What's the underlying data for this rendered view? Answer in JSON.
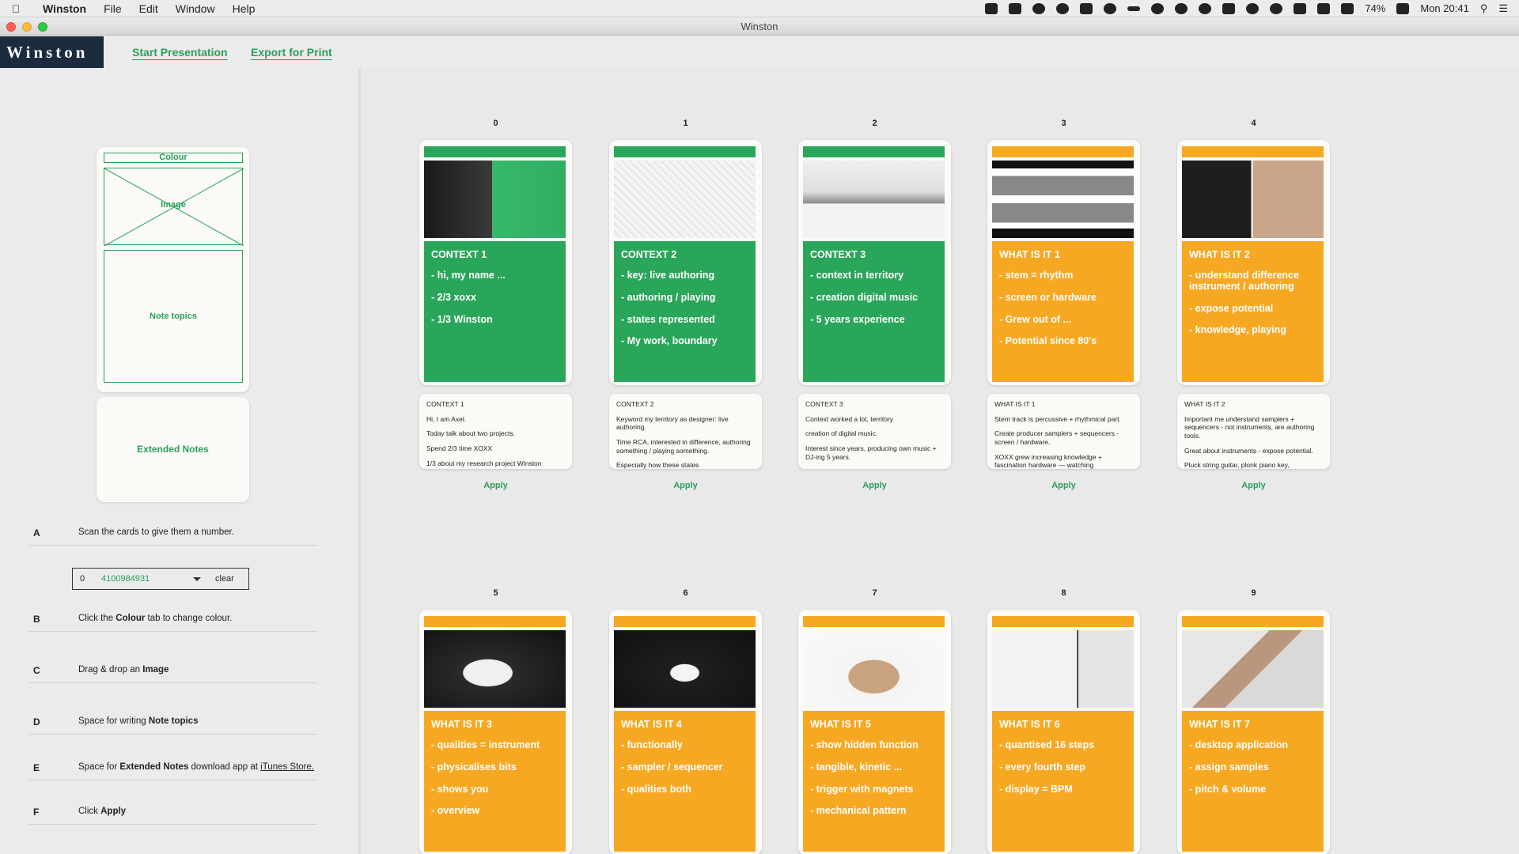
{
  "menubar": {
    "app_name": "Winston",
    "menus": [
      "File",
      "Edit",
      "Window",
      "Help"
    ],
    "battery": "74%",
    "clock": "Mon 20:41"
  },
  "window": {
    "title": "Winston"
  },
  "header": {
    "logo": "Winston",
    "start_presentation": "Start Presentation",
    "export_for_print": "Export for Print"
  },
  "legend": {
    "colour": "Colour",
    "image": "Image",
    "note_topics": "Note topics",
    "extended_notes": "Extended Notes"
  },
  "steps": [
    {
      "letter": "A",
      "text": "Scan the cards to give them a number."
    },
    {
      "letter": "B",
      "pre": "Click the ",
      "bold": "Colour",
      "post": " tab to change colour."
    },
    {
      "letter": "C",
      "pre": "Drag & drop an ",
      "bold": "Image"
    },
    {
      "letter": "D",
      "pre": "Space for writing  ",
      "bold": "Note topics"
    },
    {
      "letter": "E",
      "pre": "Space for ",
      "bold": "Extended Notes",
      "post": " download app at ",
      "link": "iTunes Store."
    },
    {
      "letter": "F",
      "pre": "Click  ",
      "bold": "Apply"
    }
  ],
  "scanner": {
    "number": "0",
    "code": "4100984931",
    "clear": "clear"
  },
  "colors": {
    "green": "#2aa65a",
    "orange": "#f7a823",
    "accent": "#2aa05a",
    "logo_bg": "#1c2a3d"
  },
  "apply_label": "Apply",
  "cards": [
    {
      "num": "0",
      "color": "green",
      "image": "hand-on-device-photo",
      "title": "CONTEXT 1",
      "topics": [
        "- hi, my name ...",
        "- 2/3 xoxx",
        "- 1/3 Winston"
      ],
      "note_title": "CONTEXT 1",
      "notes": [
        "Hi, I am Axel.",
        "Today talk about two projects.",
        "Spend 2/3 time XOXX",
        "1/3 about my research project Winston"
      ]
    },
    {
      "num": "1",
      "color": "green",
      "image": "sketch-collage",
      "title": "CONTEXT 2",
      "topics": [
        "- key: live authoring",
        "- authoring / playing",
        "- states represented",
        "- My work, boundary"
      ],
      "note_title": "CONTEXT 2",
      "notes": [
        "Keyword my territory as designer:  live authoring.",
        "Time RCA,  interested in difference, authoring something / playing something.",
        "Especially how these states"
      ]
    },
    {
      "num": "2",
      "color": "green",
      "image": "studio-shelf-photo",
      "title": "CONTEXT 3",
      "topics": [
        "- context in territory",
        "- creation digital music",
        "- 5 years experience"
      ],
      "note_title": "CONTEXT 3",
      "notes": [
        "Context worked a lot,  territory",
        "creation of digital music.",
        "Interest since years, producing own music + DJ-ing 5 years."
      ]
    },
    {
      "num": "3",
      "color": "orange",
      "image": "hardware-samplers-grid",
      "title": "WHAT IS IT 1",
      "topics": [
        "- stem  = rhythm",
        "- screen or hardware",
        "-  Grew out of ...",
        "- Potential since 80's"
      ],
      "note_title": "WHAT IS IT 1",
      "notes": [
        "Stem track is percussive + rhythmical part.",
        "Create producer samplers + sequencers -  screen / hardware.",
        "XOXX grew increasing knowledge + fascination hardware — watching"
      ]
    },
    {
      "num": "4",
      "color": "orange",
      "image": "sequencer-and-piano-photo",
      "title": "WHAT IS IT 2",
      "topics": [
        "- understand difference instrument / authoring",
        "- expose potential",
        "- knowledge, playing"
      ],
      "note_title": "WHAT IS IT 2",
      "notes": [
        "Important me understand samplers + sequencers - not instruments, are authoring tools.",
        "Great about instruments - expose potential.",
        "Pluck string  guitar, plonk piano key,"
      ]
    },
    {
      "num": "5",
      "color": "orange",
      "image": "disc-device-photo",
      "title": "WHAT IS IT 3",
      "topics": [
        "- qualities = instrument",
        "- physicalises bits",
        "- shows you",
        "- overview"
      ]
    },
    {
      "num": "6",
      "color": "orange",
      "image": "single-disc-device-photo",
      "title": "WHAT IS IT 4",
      "topics": [
        "- functionally",
        "- sampler / sequencer",
        "- qualities both"
      ]
    },
    {
      "num": "7",
      "color": "orange",
      "image": "man-holding-device-photo",
      "title": "WHAT IS IT 5",
      "topics": [
        "- show hidden function",
        "- tangible, kinetic ...",
        "- trigger with magnets",
        "- mechanical pattern"
      ]
    },
    {
      "num": "8",
      "color": "orange",
      "image": "disc-drawing-photo",
      "title": "WHAT IS IT 6",
      "topics": [
        "- quantised 16 steps",
        "- every fourth step",
        "- display = BPM"
      ]
    },
    {
      "num": "9",
      "color": "orange",
      "image": "desktop-app-photo",
      "title": "WHAT IS IT 7",
      "topics": [
        "- desktop application",
        "- assign samples",
        "- pitch & volume"
      ]
    }
  ]
}
